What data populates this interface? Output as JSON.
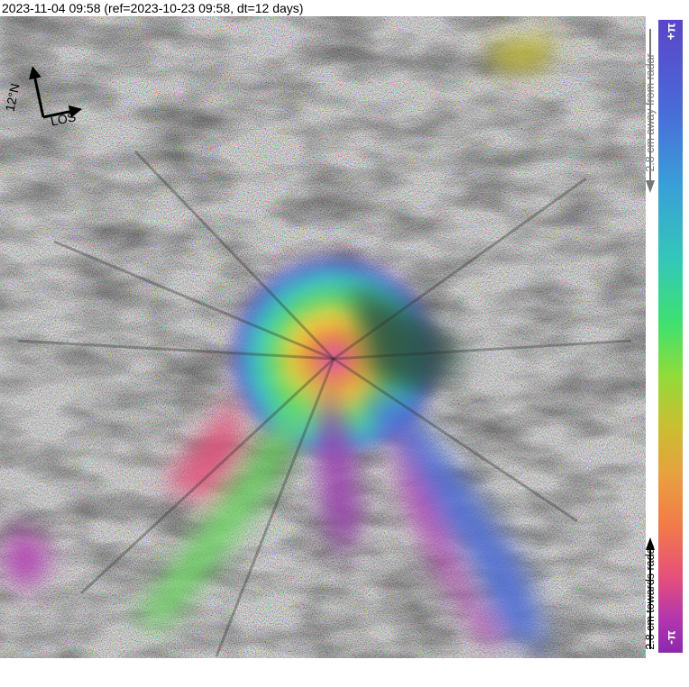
{
  "title": "2023-11-04 09:58 (ref=2023-10-23 09:58, dt=12 days)",
  "compass": {
    "north_label": "12°N",
    "los_label": "LOS",
    "icon": "north-arrow-icon"
  },
  "colorbar": {
    "top_label": "+π",
    "bottom_label": "-π",
    "away_label": "2.8 cm away from radar",
    "towards_label": "2.8 cm towards radar",
    "colors": [
      "#5a45c8",
      "#3a9ed8",
      "#3fe070",
      "#c8c030",
      "#f27a4a",
      "#e6507a",
      "#8a2aaa"
    ]
  },
  "image": {
    "subject": "volcano-interferogram"
  }
}
